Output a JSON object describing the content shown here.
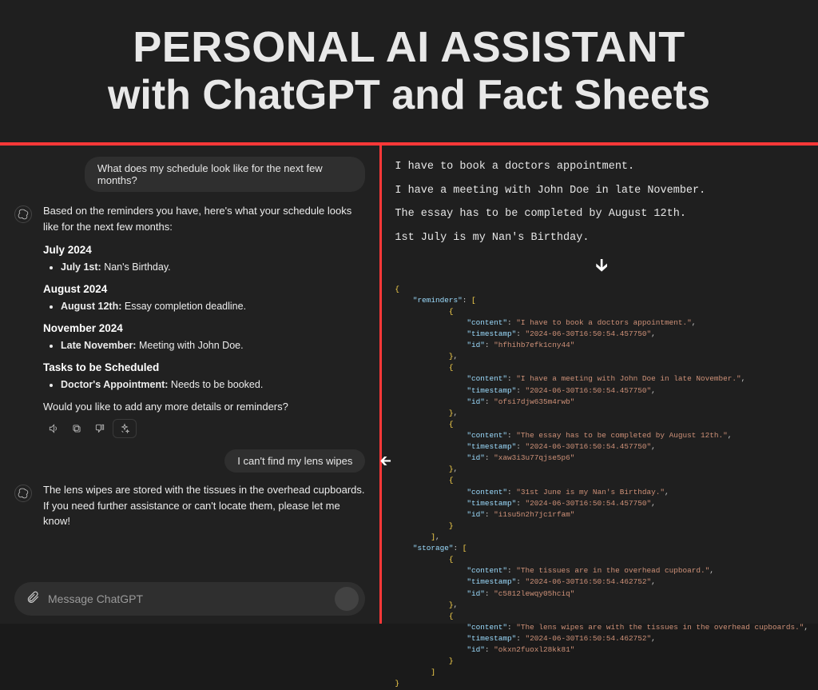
{
  "header": {
    "line1": "PERSONAL AI ASSISTANT",
    "line2": "with ChatGPT and Fact Sheets"
  },
  "chat": {
    "user1": "What does my schedule look like for the next few months?",
    "intro": "Based on the reminders you have, here's what your schedule looks like for the next few months:",
    "sections": [
      {
        "title": "July 2024",
        "item_label": "July 1st:",
        "item_text": " Nan's Birthday."
      },
      {
        "title": "August 2024",
        "item_label": "August 12th:",
        "item_text": " Essay completion deadline."
      },
      {
        "title": "November 2024",
        "item_label": "Late November:",
        "item_text": " Meeting with John Doe."
      },
      {
        "title": "Tasks to be Scheduled",
        "item_label": "Doctor's Appointment:",
        "item_text": " Needs to be booked."
      }
    ],
    "closing": "Would you like to add any more details or reminders?",
    "user2": "I can't find my lens wipes",
    "response2": "The lens wipes are stored with the tissues in the overhead cupboards. If you need further assistance or can't locate them, please let me know!",
    "input_placeholder": "Message ChatGPT"
  },
  "facts": {
    "lines": [
      "I have to book a doctors appointment.",
      "I have a meeting with John Doe in late November.",
      "The essay has to be completed by August 12th.",
      "1st July is my Nan's Birthday."
    ]
  },
  "json_block": {
    "reminders": [
      {
        "content": "I have to book a doctors appointment.",
        "timestamp": "2024-06-30T16:50:54.457750",
        "id": "hfhihb7efk1cny44"
      },
      {
        "content": "I have a meeting with John Doe in late November.",
        "timestamp": "2024-06-30T16:50:54.457750",
        "id": "ofsi7djw635m4rwb"
      },
      {
        "content": "The essay has to be completed by August 12th.",
        "timestamp": "2024-06-30T16:50:54.457750",
        "id": "xaw3i3u77qjse5p6"
      },
      {
        "content": "31st June is my Nan's Birthday.",
        "timestamp": "2024-06-30T16:50:54.457750",
        "id": "i1su5n2h7jc1rfam"
      }
    ],
    "storage": [
      {
        "content": "The tissues are in the overhead cupboard.",
        "timestamp": "2024-06-30T16:50:54.462752",
        "id": "c5812lewqy05hciq"
      },
      {
        "content": "The lens wipes are with the tissues in the overhead cupboards.",
        "timestamp": "2024-06-30T16:50:54.462752",
        "id": "okxn2fuoxl28kk81"
      }
    ]
  }
}
